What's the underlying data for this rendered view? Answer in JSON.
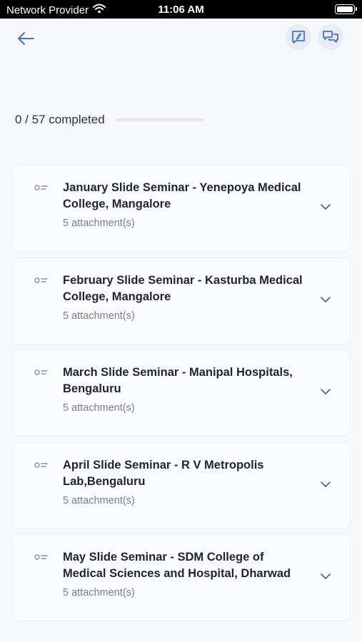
{
  "status": {
    "carrier": "Network Provider",
    "time": "11:06 AM"
  },
  "progress": {
    "label": "0 / 57 completed",
    "fraction": 0.0
  },
  "items": [
    {
      "title": "January Slide Seminar - Yenepoya Medical College, Mangalore",
      "attachments": "5 attachment(s)"
    },
    {
      "title": "February Slide Seminar - Kasturba Medical College, Mangalore",
      "attachments": "5 attachment(s)"
    },
    {
      "title": "March Slide Seminar - Manipal Hospitals,  Bengaluru",
      "attachments": "5 attachment(s)"
    },
    {
      "title": "April Slide Seminar - R V Metropolis Lab,Bengaluru",
      "attachments": "5 attachment(s)"
    },
    {
      "title": "May Slide Seminar - SDM College of Medical Sciences and Hospital, Dharwad",
      "attachments": "5 attachment(s)"
    }
  ],
  "colors": {
    "accent": "#4a6fd1",
    "background": "#f7f8fc"
  }
}
